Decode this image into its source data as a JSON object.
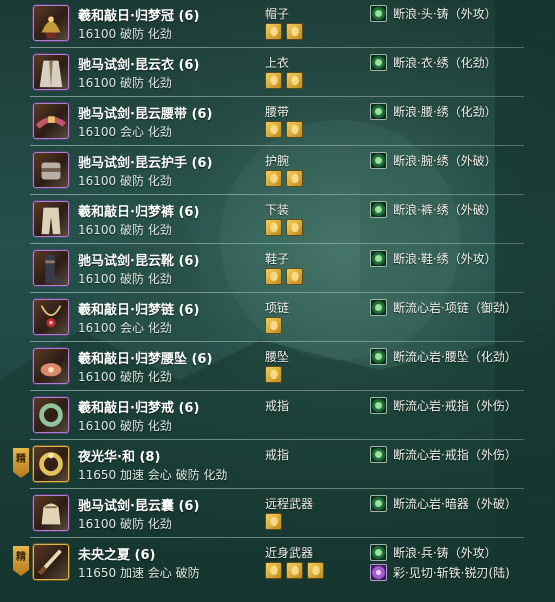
{
  "rows": [
    {
      "badge": "",
      "name": "羲和敲日·归梦冠 (6)",
      "stats": "16100 破防 化劲",
      "slot": "帽子",
      "gems": 2,
      "enh": "断浪·头·铸（外攻）",
      "enh2": "",
      "icon": "helmet-icon",
      "frame": "purple"
    },
    {
      "badge": "",
      "name": "驰马试剑·昆云衣 (6)",
      "stats": "16100 破防 化劲",
      "slot": "上衣",
      "gems": 2,
      "enh": "断浪·衣·绣（化劲）",
      "enh2": "",
      "icon": "robe-icon",
      "frame": "purple"
    },
    {
      "badge": "",
      "name": "驰马试剑·昆云腰带 (6)",
      "stats": "16100 会心 化劲",
      "slot": "腰带",
      "gems": 2,
      "enh": "断浪·腰·绣（化劲）",
      "enh2": "",
      "icon": "belt-icon",
      "frame": "purple"
    },
    {
      "badge": "",
      "name": "驰马试剑·昆云护手 (6)",
      "stats": "16100 破防 化劲",
      "slot": "护腕",
      "gems": 2,
      "enh": "断浪·腕·绣（外破）",
      "enh2": "",
      "icon": "bracer-icon",
      "frame": "purple"
    },
    {
      "badge": "",
      "name": "羲和敲日·归梦裤 (6)",
      "stats": "16100 破防 化劲",
      "slot": "下装",
      "gems": 2,
      "enh": "断浪·裤·绣（外破）",
      "enh2": "",
      "icon": "pants-icon",
      "frame": "purple"
    },
    {
      "badge": "",
      "name": "驰马试剑·昆云靴 (6)",
      "stats": "16100 破防 化劲",
      "slot": "鞋子",
      "gems": 2,
      "enh": "断浪·鞋·绣（外攻）",
      "enh2": "",
      "icon": "boots-icon",
      "frame": "purple"
    },
    {
      "badge": "",
      "name": "羲和敲日·归梦链 (6)",
      "stats": "16100 会心 化劲",
      "slot": "项链",
      "gems": 1,
      "enh": "断流心岩·项链（御劲）",
      "enh2": "",
      "icon": "necklace-icon",
      "frame": "purple"
    },
    {
      "badge": "",
      "name": "羲和敲日·归梦腰坠 (6)",
      "stats": "16100 破防 化劲",
      "slot": "腰坠",
      "gems": 1,
      "enh": "断流心岩·腰坠（化劲）",
      "enh2": "",
      "icon": "pendant-icon",
      "frame": "purple"
    },
    {
      "badge": "",
      "name": "羲和敲日·归梦戒 (6)",
      "stats": "16100 破防 化劲",
      "slot": "戒指",
      "gems": 0,
      "enh": "断流心岩·戒指（外伤）",
      "enh2": "",
      "icon": "ring-icon",
      "frame": "purple"
    },
    {
      "badge": "精",
      "name": "夜光华·和 (8)",
      "stats": "11650 加速 会心 破防 化劲",
      "slot": "戒指",
      "gems": 0,
      "enh": "断流心岩·戒指（外伤）",
      "enh2": "",
      "icon": "ring-gold-icon",
      "frame": "gold"
    },
    {
      "badge": "",
      "name": "驰马试剑·昆云囊 (6)",
      "stats": "16100 破防 化劲",
      "slot": "远程武器",
      "gems": 1,
      "enh": "断流心岩·暗器（外破）",
      "enh2": "",
      "icon": "pouch-icon",
      "frame": "purple"
    },
    {
      "badge": "精",
      "name": "未央之夏 (6)",
      "stats": "11650 加速 会心 破防",
      "slot": "近身武器",
      "gems": 3,
      "enh": "断浪·兵·铸（外攻）",
      "enh2": "彩·见切·斩铁·锐刃(陆)",
      "icon": "weapon-icon",
      "frame": "gold"
    }
  ]
}
